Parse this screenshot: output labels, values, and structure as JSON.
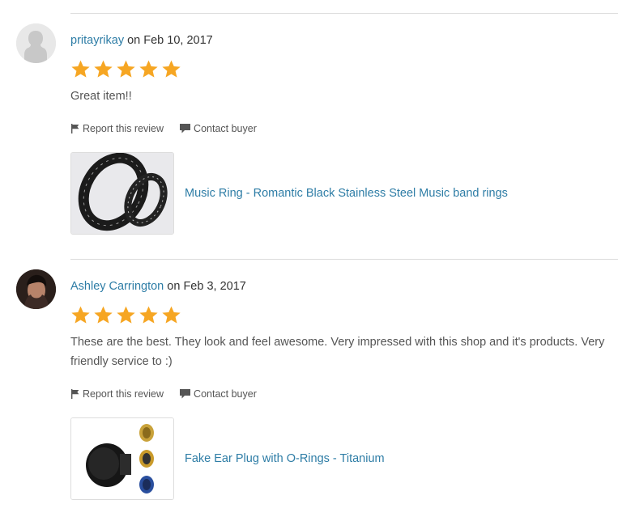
{
  "colors": {
    "link": "#2e7da6",
    "star": "#f6a623",
    "text": "#555555",
    "divider": "#dcdcdc"
  },
  "reviews": [
    {
      "username": "pritayrikay",
      "date_prefix": " on ",
      "date": "Feb 10, 2017",
      "rating": 5,
      "text": "Great item!!",
      "report_label": "Report this review",
      "contact_label": "Contact buyer",
      "listing_title": "Music Ring - Romantic Black Stainless Steel Music band rings",
      "avatar_icon": "default-user-silhouette",
      "thumb_icon": "music-rings-photo"
    },
    {
      "username": "Ashley Carrington",
      "date_prefix": " on ",
      "date": "Feb 3, 2017",
      "rating": 5,
      "text": "These are the best. They look and feel awesome. Very impressed with this shop and it's products. Very friendly service to :)",
      "report_label": "Report this review",
      "contact_label": "Contact buyer",
      "listing_title": "Fake Ear Plug with O-Rings - Titanium",
      "avatar_icon": "user-photo",
      "thumb_icon": "ear-plugs-photo"
    }
  ]
}
